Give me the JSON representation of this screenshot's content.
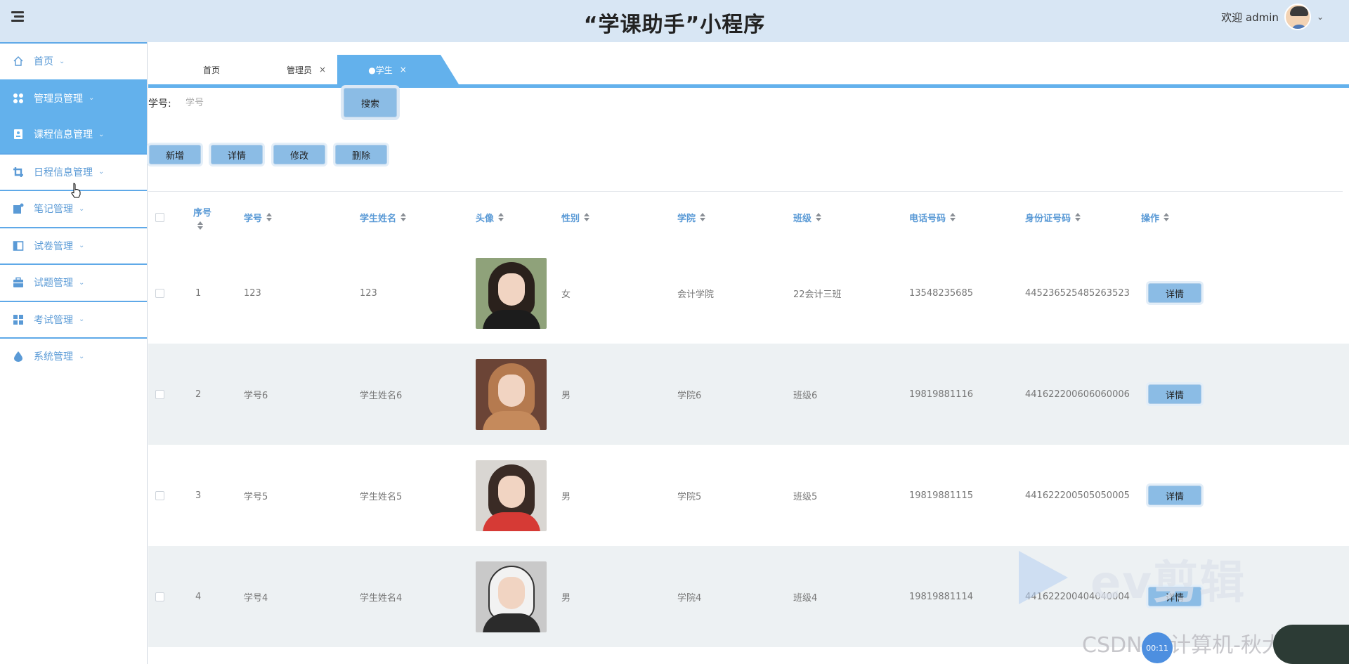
{
  "app": {
    "title": "“学课助手”小程序"
  },
  "user": {
    "greeting": "欢迎 admin"
  },
  "sidebar": {
    "items": [
      {
        "label": "首页",
        "icon": "home-icon"
      },
      {
        "label": "管理员管理",
        "icon": "grid-circles-icon"
      },
      {
        "label": "课程信息管理",
        "icon": "id-card-icon"
      },
      {
        "label": "日程信息管理",
        "icon": "crop-icon"
      },
      {
        "label": "笔记管理",
        "icon": "note-icon"
      },
      {
        "label": "试卷管理",
        "icon": "panel-icon"
      },
      {
        "label": "试题管理",
        "icon": "briefcase-icon"
      },
      {
        "label": "考试管理",
        "icon": "grid-squares-icon"
      },
      {
        "label": "系统管理",
        "icon": "drop-icon"
      }
    ]
  },
  "tabs": [
    {
      "label": "首页"
    },
    {
      "label": "管理员",
      "close": "×"
    },
    {
      "label": "●学生",
      "close": "×"
    }
  ],
  "search": {
    "label": "学号:",
    "placeholder": "学号",
    "button": "搜索"
  },
  "actions": {
    "add": "新增",
    "detail": "详情",
    "edit": "修改",
    "delete": "删除"
  },
  "table": {
    "headers": [
      "序号",
      "学号",
      "学生姓名",
      "头像",
      "性别",
      "学院",
      "班级",
      "电话号码",
      "身份证号码",
      "操作"
    ],
    "rows": [
      {
        "seq": "1",
        "id": "123",
        "name": "123",
        "gender": "女",
        "college": "会计学院",
        "class": "22会计三班",
        "phone": "13548235685",
        "idcard": "445236525485263523",
        "action": "详情"
      },
      {
        "seq": "2",
        "id": "学号6",
        "name": "学生姓名6",
        "gender": "男",
        "college": "学院6",
        "class": "班级6",
        "phone": "19819881116",
        "idcard": "441622200606060006",
        "action": "详情"
      },
      {
        "seq": "3",
        "id": "学号5",
        "name": "学生姓名5",
        "gender": "男",
        "college": "学院5",
        "class": "班级5",
        "phone": "19819881115",
        "idcard": "441622200505050005",
        "action": "详情"
      },
      {
        "seq": "4",
        "id": "学号4",
        "name": "学生姓名4",
        "gender": "男",
        "college": "学院4",
        "class": "班级4",
        "phone": "19819881114",
        "idcard": "441622200404040004",
        "action": "详情"
      }
    ]
  },
  "watermark": {
    "brand": "ev剪辑",
    "credit": "CSDN @计算机-秋大田",
    "rec_time": "00:11"
  },
  "colors": {
    "accent": "#63b1ec",
    "header_bg": "#d8e6f4",
    "button_bg": "#8bbce5",
    "link_text": "#5a9ad6"
  }
}
